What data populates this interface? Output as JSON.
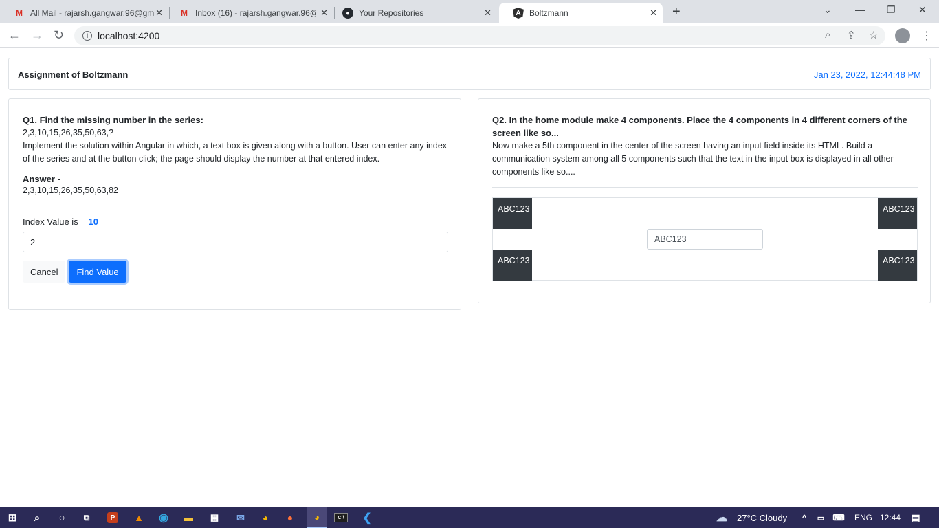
{
  "browser": {
    "tabs": [
      {
        "title": "All Mail - rajarsh.gangwar.96@gm",
        "icon": "gmail-icon"
      },
      {
        "title": "Inbox (16) - rajarsh.gangwar.96@",
        "icon": "gmail-icon"
      },
      {
        "title": "Your Repositories",
        "icon": "github-icon"
      },
      {
        "title": "Boltzmann",
        "icon": "angular-icon"
      }
    ],
    "url": "localhost:4200"
  },
  "header": {
    "title": "Assignment of Boltzmann",
    "datetime": "Jan 23, 2022, 12:44:48 PM"
  },
  "q1": {
    "question": "Q1. Find the missing number in the series:",
    "series": "2,3,10,15,26,35,50,63,?",
    "description": "Implement the solution within Angular in which, a text box is given along with a button. User can enter any index of the series and at the button click; the page should display the number at that entered index.",
    "answer_label": "Answer",
    "answer_dash": " -",
    "answer": "2,3,10,15,26,35,50,63,82",
    "index_label": "Index Value is = ",
    "index_value": "10",
    "input_value": "2",
    "cancel_label": "Cancel",
    "find_label": "Find Value"
  },
  "q2": {
    "question": "Q2. In the home module make 4 components. Place the 4 components in 4 different corners of the screen like so...",
    "description": "Now make a 5th component in the center of the screen having an input field inside its HTML. Build a communication system among all 5 components such that the text in the input box is displayed in all other components like so....",
    "corner_top_left": "ABC123",
    "corner_top_right": "ABC123",
    "corner_bottom_left": "ABC123",
    "corner_bottom_right": "ABC123",
    "center_input": "ABC123"
  },
  "taskbar": {
    "weather": "27°C  Cloudy",
    "language": "ENG",
    "time": "12:44"
  },
  "colors": {
    "primary": "#0d6efd",
    "dark_box": "#343a40",
    "taskbar": "#2b2a57"
  }
}
